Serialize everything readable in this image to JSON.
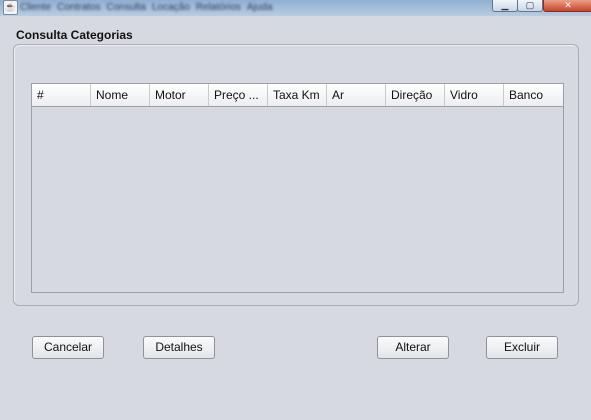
{
  "window": {
    "menu_items": [
      "Cliente",
      "Contratos",
      "Consulta",
      "Locação",
      "Relatórios",
      "Ajuda"
    ],
    "icon": "java-icon",
    "controls": {
      "minimize": "minimize-icon",
      "maximize": "maximize-icon",
      "close": "close-icon"
    }
  },
  "panel": {
    "title": "Consulta Categorias"
  },
  "table": {
    "columns": [
      "#",
      "Nome",
      "Motor",
      "Preço ...",
      "Taxa Km",
      "Ar",
      "Direção",
      "Vidro",
      "Banco"
    ],
    "rows": []
  },
  "buttons": {
    "cancelar": "Cancelar",
    "detalhes": "Detalhes",
    "alterar": "Alterar",
    "excluir": "Excluir"
  }
}
